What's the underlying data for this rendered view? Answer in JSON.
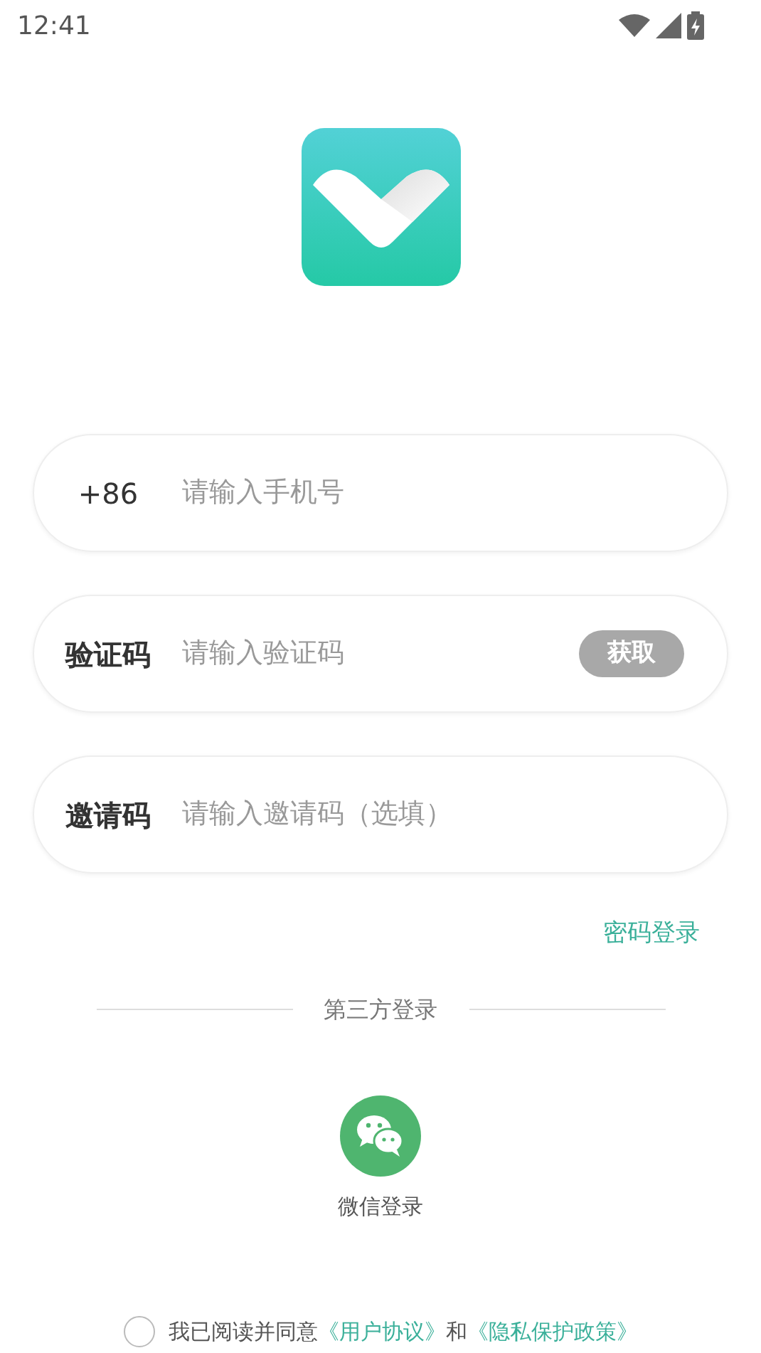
{
  "status_bar": {
    "time": "12:41"
  },
  "fields": [
    {
      "kind": "phone",
      "label": "+86",
      "placeholder": "请输入手机号"
    },
    {
      "kind": "code",
      "label": "验证码",
      "placeholder": "请输入验证码",
      "button": {
        "label": "获取",
        "disabled": true
      }
    },
    {
      "kind": "invite",
      "label": "邀请码",
      "placeholder": "请输入邀请码（选填）"
    }
  ],
  "password_login": "密码登录",
  "third_party": {
    "title": "第三方登录",
    "options": [
      {
        "label": "微信登录"
      }
    ]
  },
  "agreement": {
    "checked": false,
    "parts": [
      {
        "kind": "text",
        "text": "我已阅读并同意"
      },
      {
        "kind": "link",
        "text": "《用户协议》"
      },
      {
        "kind": "text",
        "text": "和"
      },
      {
        "kind": "link",
        "text": "《隐私保护政策》"
      }
    ]
  }
}
